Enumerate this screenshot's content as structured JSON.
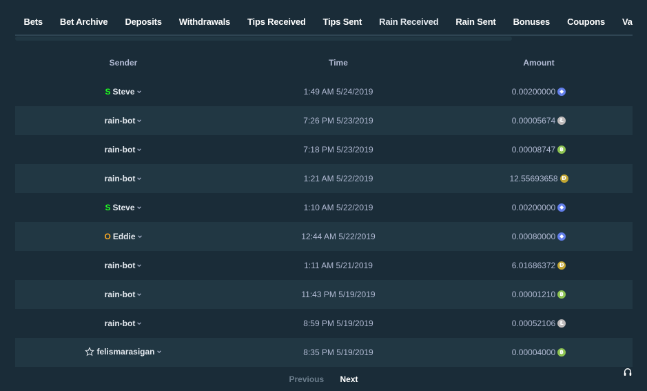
{
  "tabs": [
    {
      "label": "Bets"
    },
    {
      "label": "Bet Archive"
    },
    {
      "label": "Deposits"
    },
    {
      "label": "Withdrawals"
    },
    {
      "label": "Tips Received"
    },
    {
      "label": "Tips Sent"
    },
    {
      "label": "Rain Received",
      "active": true
    },
    {
      "label": "Rain Sent"
    },
    {
      "label": "Bonuses"
    },
    {
      "label": "Coupons"
    },
    {
      "label": "Vault Depo"
    }
  ],
  "table": {
    "headers": {
      "sender": "Sender",
      "time": "Time",
      "amount": "Amount"
    },
    "rows": [
      {
        "rank": "S",
        "rank_color": "#1fff20",
        "sender": "Steve",
        "time": "1:49 AM 5/24/2019",
        "amount": "0.00200000",
        "coin": "eth-icon"
      },
      {
        "rank": "",
        "sender": "rain-bot",
        "time": "7:26 PM 5/23/2019",
        "amount": "0.00005674",
        "coin": "ltc-icon"
      },
      {
        "rank": "",
        "sender": "rain-bot",
        "time": "7:18 PM 5/23/2019",
        "amount": "0.00008747",
        "coin": "bch-icon"
      },
      {
        "rank": "",
        "sender": "rain-bot",
        "time": "1:21 AM 5/22/2019",
        "amount": "12.55693658",
        "coin": "doge-icon"
      },
      {
        "rank": "S",
        "rank_color": "#1fff20",
        "sender": "Steve",
        "time": "1:10 AM 5/22/2019",
        "amount": "0.00200000",
        "coin": "eth-icon"
      },
      {
        "rank": "O",
        "rank_color": "#f5a623",
        "sender": "Eddie",
        "time": "12:44 AM 5/22/2019",
        "amount": "0.00080000",
        "coin": "eth-icon"
      },
      {
        "rank": "",
        "sender": "rain-bot",
        "time": "1:11 AM 5/21/2019",
        "amount": "6.01686372",
        "coin": "doge-icon"
      },
      {
        "rank": "",
        "sender": "rain-bot",
        "time": "11:43 PM 5/19/2019",
        "amount": "0.00001210",
        "coin": "bch-icon"
      },
      {
        "rank": "",
        "sender": "rain-bot",
        "time": "8:59 PM 5/19/2019",
        "amount": "0.00052106",
        "coin": "ltc-icon"
      },
      {
        "rank": "star",
        "sender": "felismarasigan",
        "time": "8:35 PM 5/19/2019",
        "amount": "0.00004000",
        "coin": "bch-icon"
      }
    ]
  },
  "pager": {
    "prev": "Previous",
    "next": "Next"
  },
  "colors": {
    "background": "#1a2c38",
    "row_alt": "#213743",
    "accent": "#1475e1",
    "eth": "#627eea",
    "ltc": "#bfbbbb",
    "bch": "#8dc351",
    "doge": "#c2a633"
  },
  "icons": {
    "support": "headset-icon",
    "star": "star-icon",
    "chevron": "chevron-down-icon"
  }
}
